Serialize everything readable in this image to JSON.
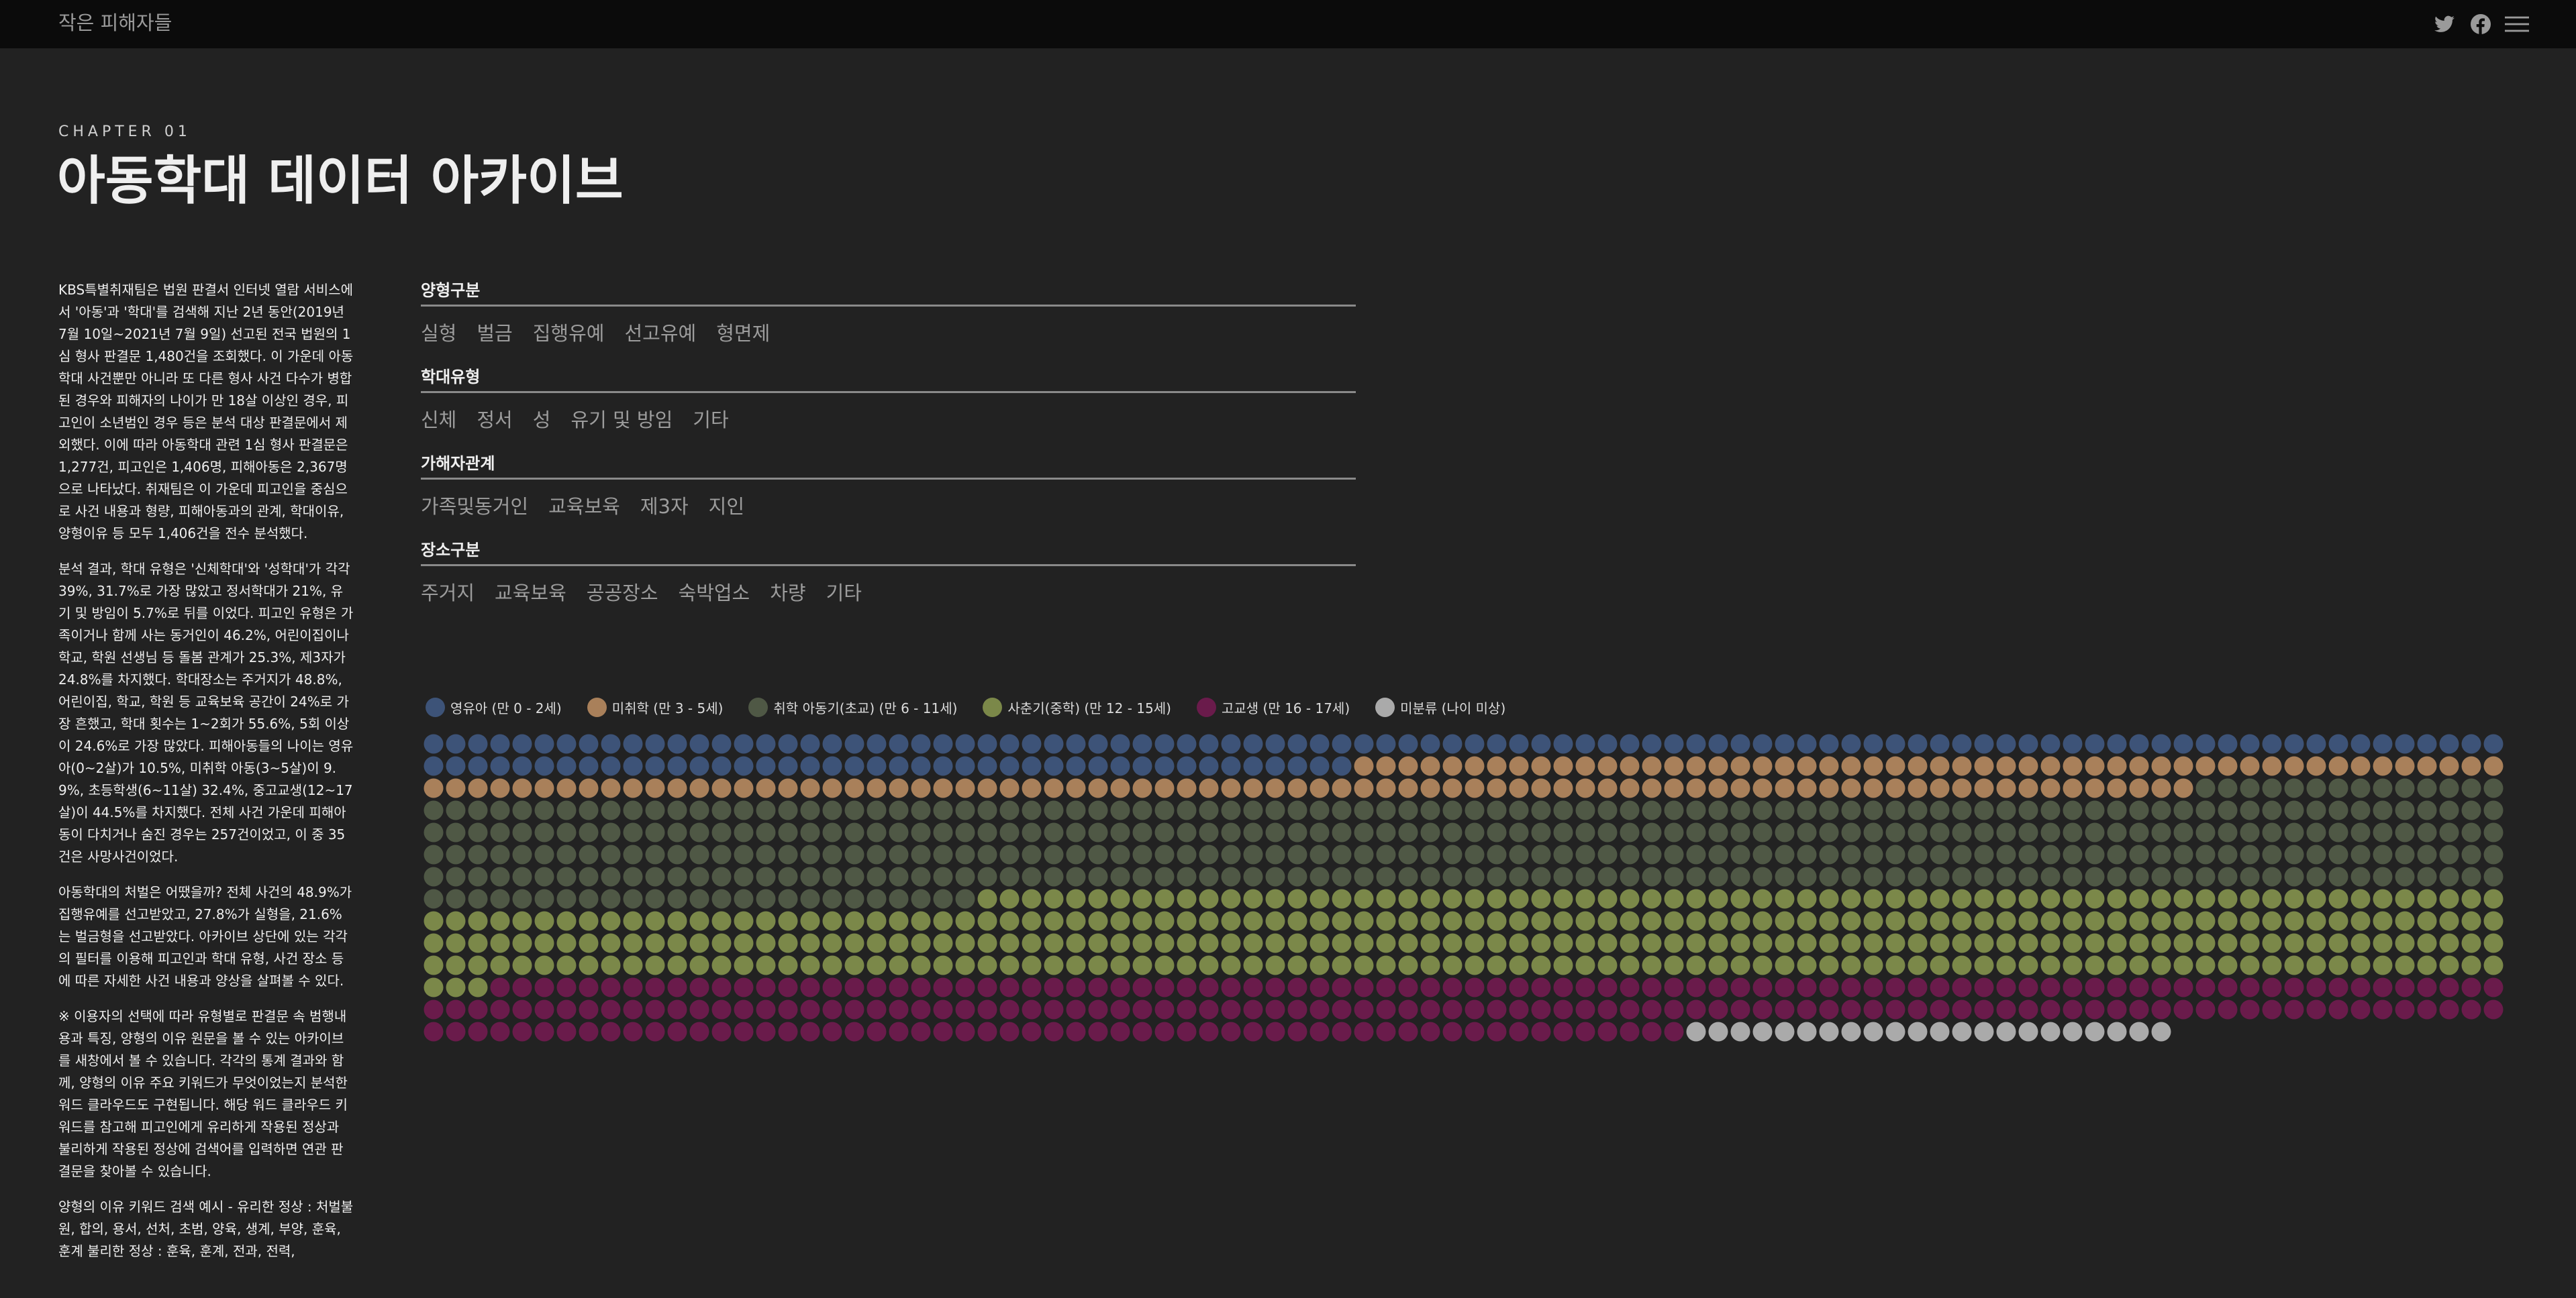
{
  "header": {
    "site_name": "작은 피해자들",
    "icons": [
      "twitter-icon",
      "facebook-icon",
      "menu-icon"
    ]
  },
  "chapter": {
    "label": "CHAPTER 01",
    "title": "아동학대 데이터 아카이브"
  },
  "article": {
    "paragraphs": [
      "KBS특별취재팀은 법원 판결서 인터넷 열람 서비스에서 '아동'과 '학대'를 검색해 지난 2년 동안(2019년 7월 10일~2021년 7월 9일) 선고된 전국 법원의 1심 형사 판결문 1,480건을 조회했다. 이 가운데 아동학대 사건뿐만 아니라 또 다른 형사 사건 다수가 병합된 경우와 피해자의 나이가 만 18살 이상인 경우, 피고인이 소년범인 경우 등은 분석 대상 판결문에서 제외했다. 이에 따라 아동학대 관련 1심 형사 판결문은 1,277건, 피고인은 1,406명, 피해아동은 2,367명으로 나타났다. 취재팀은 이 가운데 피고인을 중심으로 사건 내용과 형량, 피해아동과의 관계, 학대이유, 양형이유 등 모두 1,406건을 전수 분석했다.",
      "분석 결과, 학대 유형은 '신체학대'와 '성학대'가 각각 39%, 31.7%로 가장 많았고 정서학대가 21%, 유기 및 방임이 5.7%로 뒤를 이었다. 피고인 유형은 가족이거나 함께 사는 동거인이 46.2%, 어린이집이나 학교, 학원 선생님 등 돌봄 관계가 25.3%, 제3자가 24.8%를 차지했다. 학대장소는 주거지가 48.8%, 어린이집, 학교, 학원 등 교육보육 공간이 24%로 가장 흔했고, 학대 횟수는 1~2회가 55.6%, 5회 이상이 24.6%로 가장 많았다. 피해아동들의 나이는 영유아(0~2살)가 10.5%, 미취학 아동(3~5살)이 9.9%, 초등학생(6~11살) 32.4%, 중고교생(12~17살)이 44.5%를 차지했다. 전체 사건 가운데 피해아동이 다치거나 숨진 경우는 257건이었고, 이 중 35건은 사망사건이었다.",
      "아동학대의 처벌은 어땠을까? 전체 사건의 48.9%가 집행유예를 선고받았고, 27.8%가 실형을, 21.6%는 벌금형을 선고받았다. 아카이브 상단에 있는 각각의 필터를 이용해 피고인과 학대 유형, 사건 장소 등에 따른 자세한 사건 내용과 양상을 살펴볼 수 있다.",
      "※ 이용자의 선택에 따라 유형별로 판결문 속 범행내용과 특징, 양형의 이유 원문을 볼 수 있는 아카이브를 새창에서 볼 수 있습니다. 각각의 통계 결과와 함께, 양형의 이유 주요 키워드가 무엇이었는지 분석한 워드 클라우드도 구현됩니다. 해당 워드 클라우드 키워드를 참고해 피고인에게 유리하게 작용된 정상과 불리하게 작용된 정상에 검색어를 입력하면 연관 판결문을 찾아볼 수 있습니다.",
      "양형의 이유 키워드 검색 예시 - 유리한 정상 : 처벌불원, 합의, 용서, 선처, 초범, 양육, 생계, 부양, 훈육, 훈계 불리한 정상 : 훈육, 훈계, 전과, 전력,"
    ]
  },
  "filters": [
    {
      "title": "양형구분",
      "options": [
        "실형",
        "벌금",
        "집행유예",
        "선고유예",
        "형면제"
      ]
    },
    {
      "title": "학대유형",
      "options": [
        "신체",
        "정서",
        "성",
        "유기 및 방임",
        "기타"
      ]
    },
    {
      "title": "가해자관계",
      "options": [
        "가족및동거인",
        "교육보육",
        "제3자",
        "지인"
      ]
    },
    {
      "title": "장소구분",
      "options": [
        "주거지",
        "교육보육",
        "공공장소",
        "숙박업소",
        "차량",
        "기타"
      ]
    }
  ],
  "legend": [
    {
      "label": "영유아 (만 0 - 2세)",
      "color": "#3d5378"
    },
    {
      "label": "미취학 (만 3 - 5세)",
      "color": "#a9805a"
    },
    {
      "label": "취학 아동기(초교) (만 6 - 11세)",
      "color": "#4f5845"
    },
    {
      "label": "사춘기(중학) (만 12 - 15세)",
      "color": "#7b8849"
    },
    {
      "label": "고교생 (만 16 - 17세)",
      "color": "#6a1b4b"
    },
    {
      "label": "미분류 (나이 미상)",
      "color": "#aaaaaa"
    }
  ],
  "chart_data": {
    "type": "unit-dot-grid",
    "columns": 94,
    "categories": [
      "영유아 (만 0 - 2세)",
      "미취학 (만 3 - 5세)",
      "취학 아동기(초교) (만 6 - 11세)",
      "사춘기(중학) (만 12 - 15세)",
      "고교생 (만 16 - 17세)",
      "미분류 (나이 미상)"
    ],
    "values": [
      136,
      132,
      415,
      354,
      242,
      22
    ],
    "colors": [
      "#3d5378",
      "#a9805a",
      "#4f5845",
      "#7b8849",
      "#6a1b4b",
      "#aaaaaa"
    ],
    "title": "",
    "xlabel": "",
    "ylabel": ""
  }
}
